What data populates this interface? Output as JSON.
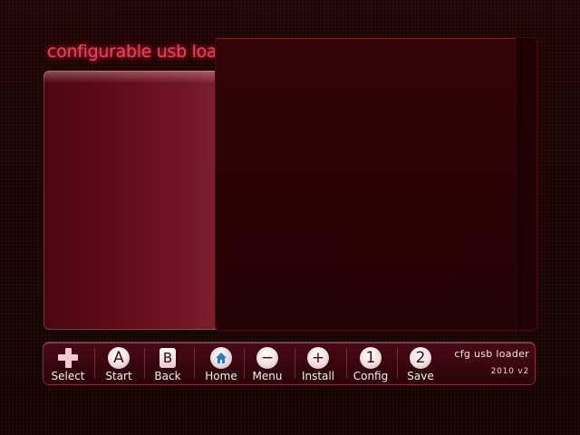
{
  "app": {
    "title": "configurable usb loader"
  },
  "footer": {
    "buttons": [
      {
        "icon": "dpad-icon",
        "glyph": "",
        "label": "Select"
      },
      {
        "icon": "a-button-icon",
        "glyph": "A",
        "label": "Start"
      },
      {
        "icon": "b-button-icon",
        "glyph": "B",
        "label": "Back"
      },
      {
        "icon": "home-icon",
        "glyph": "",
        "label": "Home"
      },
      {
        "icon": "minus-button-icon",
        "glyph": "−",
        "label": "Menu"
      },
      {
        "icon": "plus-button-icon",
        "glyph": "+",
        "label": "Install"
      },
      {
        "icon": "one-button-icon",
        "glyph": "1",
        "label": "Config"
      },
      {
        "icon": "two-button-icon",
        "glyph": "2",
        "label": "Save"
      }
    ],
    "brand_name": "cfg usb loader",
    "brand_version": "2010 v2"
  },
  "colors": {
    "background": "#120606",
    "accent": "#d0505e",
    "panel": "#5e0a17",
    "footer": "#3a0610"
  }
}
